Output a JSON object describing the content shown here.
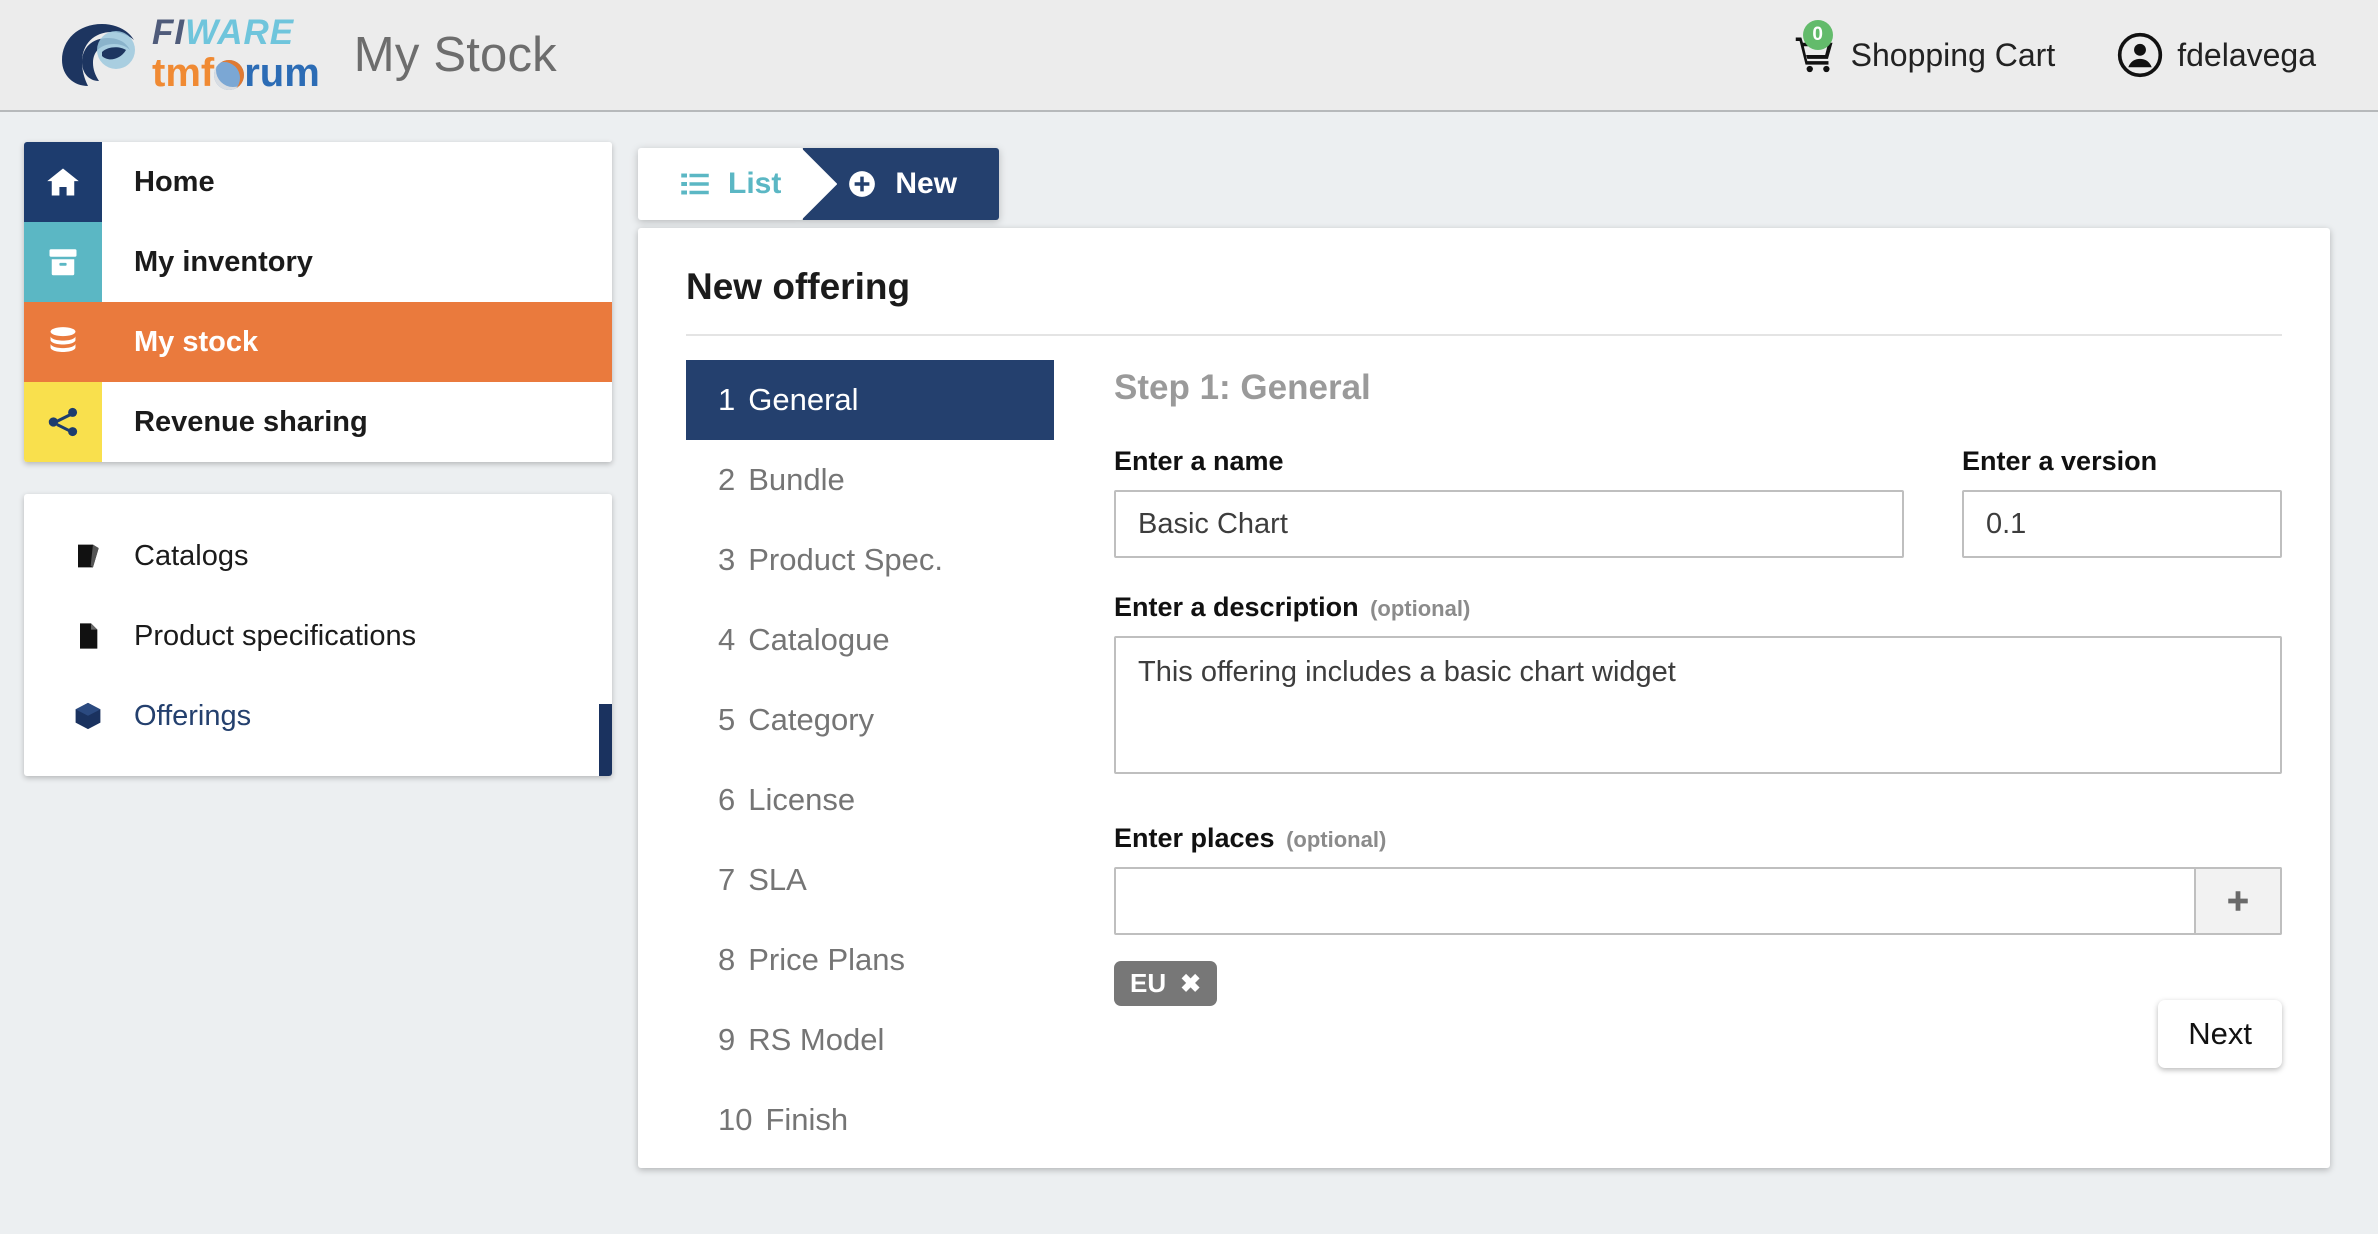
{
  "header": {
    "logo": {
      "fiware_fi": "FI",
      "fiware_ware": "WARE",
      "tmforum_tm": "tmf",
      "tmforum_orum": "rum"
    },
    "app_title": "My Stock",
    "cart_label": "Shopping Cart",
    "cart_badge": "0",
    "user_name": "fdelavega",
    "badge_color": "#63bb6b"
  },
  "sidebar": {
    "main_items": [
      {
        "label": "Home",
        "icon": "home-icon",
        "tile_color": "#1d3c6e",
        "active": false
      },
      {
        "label": "My inventory",
        "icon": "box-icon",
        "tile_color": "#5bb7c4",
        "active": false
      },
      {
        "label": "My stock",
        "icon": "database-icon",
        "tile_color": "#ea7a3d",
        "active": true
      },
      {
        "label": "Revenue sharing",
        "icon": "share-icon",
        "tile_color": "#f9e04d",
        "active": false
      }
    ],
    "section_items": [
      {
        "label": "Catalogs",
        "icon": "book-icon",
        "active": false
      },
      {
        "label": "Product specifications",
        "icon": "file-icon",
        "active": false
      },
      {
        "label": "Offerings",
        "icon": "cube-icon",
        "active": true
      }
    ]
  },
  "breadcrumb": {
    "list_label": "List",
    "list_icon": "list-icon",
    "new_label": "New",
    "new_icon": "plus-circle-icon"
  },
  "content": {
    "page_title": "New offering",
    "steps": [
      {
        "num": "1",
        "label": "General",
        "active": true
      },
      {
        "num": "2",
        "label": "Bundle",
        "active": false
      },
      {
        "num": "3",
        "label": "Product Spec.",
        "active": false
      },
      {
        "num": "4",
        "label": "Catalogue",
        "active": false
      },
      {
        "num": "5",
        "label": "Category",
        "active": false
      },
      {
        "num": "6",
        "label": "License",
        "active": false
      },
      {
        "num": "7",
        "label": "SLA",
        "active": false
      },
      {
        "num": "8",
        "label": "Price Plans",
        "active": false
      },
      {
        "num": "9",
        "label": "RS Model",
        "active": false
      },
      {
        "num": "10",
        "label": "Finish",
        "active": false
      }
    ],
    "step_heading": "Step 1: General",
    "name_label": "Enter a name",
    "name_value": "Basic Chart",
    "name_placeholder": "",
    "version_label": "Enter a version",
    "version_value": "0.1",
    "version_placeholder": "",
    "description_label": "Enter a description",
    "description_optional": "(optional)",
    "description_value": "This offering includes a basic chart widget",
    "description_placeholder": "",
    "places_label": "Enter places",
    "places_optional": "(optional)",
    "places_value": "",
    "places_placeholder": "",
    "places_add_icon": "plus-icon",
    "place_tags": [
      {
        "label": "EU",
        "remove": "✖"
      }
    ],
    "next_label": "Next"
  },
  "colors": {
    "navy": "#24406e",
    "orange": "#ea7a3d",
    "teal": "#5bb7c4",
    "yellow": "#f9e04d",
    "tag_gray": "#777777",
    "page_bg": "#eceff1"
  }
}
